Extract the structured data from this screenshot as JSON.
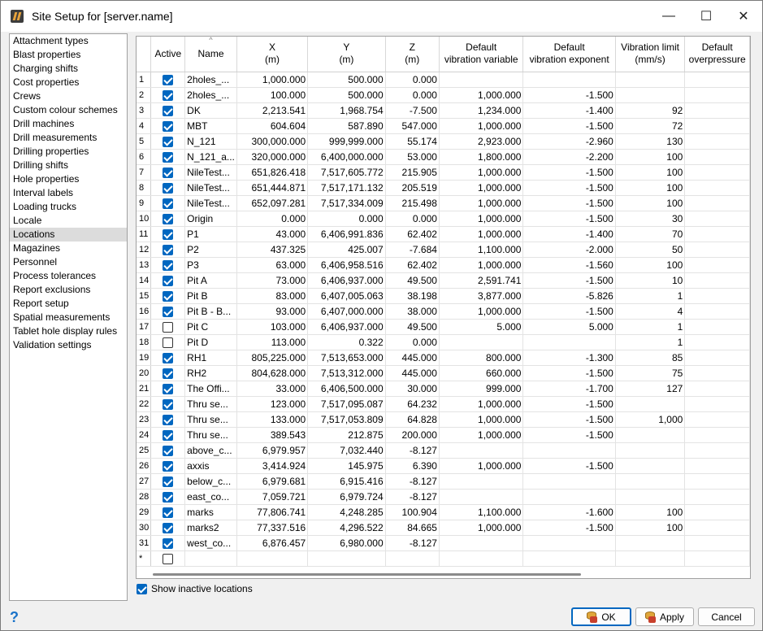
{
  "window": {
    "title": "Site Setup for [server.name]",
    "minimize": "—",
    "maximize": "☐",
    "close": "✕"
  },
  "nav": {
    "items": [
      "Attachment types",
      "Blast properties",
      "Charging shifts",
      "Cost properties",
      "Crews",
      "Custom colour schemes",
      "Drill machines",
      "Drill measurements",
      "Drilling properties",
      "Drilling shifts",
      "Hole properties",
      "Interval labels",
      "Loading trucks",
      "Locale",
      "Locations",
      "Magazines",
      "Personnel",
      "Process tolerances",
      "Report exclusions",
      "Report setup",
      "Spatial measurements",
      "Tablet hole display rules",
      "Validation settings"
    ],
    "selected": "Locations"
  },
  "grid": {
    "columns": [
      {
        "l1": "Active",
        "l2": ""
      },
      {
        "l1": "Name",
        "l2": ""
      },
      {
        "l1": "X",
        "l2": "(m)"
      },
      {
        "l1": "Y",
        "l2": "(m)"
      },
      {
        "l1": "Z",
        "l2": "(m)"
      },
      {
        "l1": "Default",
        "l2": "vibration variable"
      },
      {
        "l1": "Default",
        "l2": "vibration exponent"
      },
      {
        "l1": "Vibration limit",
        "l2": "(mm/s)"
      },
      {
        "l1": "Default",
        "l2": "overpressure"
      }
    ],
    "sort_indicator": "^",
    "rows": [
      {
        "n": "1",
        "a": true,
        "name": "2holes_...",
        "x": "1,000.000",
        "y": "500.000",
        "z": "0.000",
        "vv": "",
        "ve": "",
        "vl": ""
      },
      {
        "n": "2",
        "a": true,
        "name": "2holes_...",
        "x": "100.000",
        "y": "500.000",
        "z": "0.000",
        "vv": "1,000.000",
        "ve": "-1.500",
        "vl": ""
      },
      {
        "n": "3",
        "a": true,
        "name": "DK",
        "x": "2,213.541",
        "y": "1,968.754",
        "z": "-7.500",
        "vv": "1,234.000",
        "ve": "-1.400",
        "vl": "92"
      },
      {
        "n": "4",
        "a": true,
        "name": "MBT",
        "x": "604.604",
        "y": "587.890",
        "z": "547.000",
        "vv": "1,000.000",
        "ve": "-1.500",
        "vl": "72"
      },
      {
        "n": "5",
        "a": true,
        "name": "N_121",
        "x": "300,000.000",
        "y": "999,999.000",
        "z": "55.174",
        "vv": "2,923.000",
        "ve": "-2.960",
        "vl": "130"
      },
      {
        "n": "6",
        "a": true,
        "name": "N_121_a...",
        "x": "320,000.000",
        "y": "6,400,000.000",
        "z": "53.000",
        "vv": "1,800.000",
        "ve": "-2.200",
        "vl": "100"
      },
      {
        "n": "7",
        "a": true,
        "name": "NileTest...",
        "x": "651,826.418",
        "y": "7,517,605.772",
        "z": "215.905",
        "vv": "1,000.000",
        "ve": "-1.500",
        "vl": "100"
      },
      {
        "n": "8",
        "a": true,
        "name": "NileTest...",
        "x": "651,444.871",
        "y": "7,517,171.132",
        "z": "205.519",
        "vv": "1,000.000",
        "ve": "-1.500",
        "vl": "100"
      },
      {
        "n": "9",
        "a": true,
        "name": "NileTest...",
        "x": "652,097.281",
        "y": "7,517,334.009",
        "z": "215.498",
        "vv": "1,000.000",
        "ve": "-1.500",
        "vl": "100"
      },
      {
        "n": "10",
        "a": true,
        "name": "Origin",
        "x": "0.000",
        "y": "0.000",
        "z": "0.000",
        "vv": "1,000.000",
        "ve": "-1.500",
        "vl": "30"
      },
      {
        "n": "11",
        "a": true,
        "name": "P1",
        "x": "43.000",
        "y": "6,406,991.836",
        "z": "62.402",
        "vv": "1,000.000",
        "ve": "-1.400",
        "vl": "70"
      },
      {
        "n": "12",
        "a": true,
        "name": "P2",
        "x": "437.325",
        "y": "425.007",
        "z": "-7.684",
        "vv": "1,100.000",
        "ve": "-2.000",
        "vl": "50"
      },
      {
        "n": "13",
        "a": true,
        "name": "P3",
        "x": "63.000",
        "y": "6,406,958.516",
        "z": "62.402",
        "vv": "1,000.000",
        "ve": "-1.560",
        "vl": "100"
      },
      {
        "n": "14",
        "a": true,
        "name": "Pit A",
        "x": "73.000",
        "y": "6,406,937.000",
        "z": "49.500",
        "vv": "2,591.741",
        "ve": "-1.500",
        "vl": "10"
      },
      {
        "n": "15",
        "a": true,
        "name": "Pit B",
        "x": "83.000",
        "y": "6,407,005.063",
        "z": "38.198",
        "vv": "3,877.000",
        "ve": "-5.826",
        "vl": "1"
      },
      {
        "n": "16",
        "a": true,
        "name": "Pit B - B...",
        "x": "93.000",
        "y": "6,407,000.000",
        "z": "38.000",
        "vv": "1,000.000",
        "ve": "-1.500",
        "vl": "4"
      },
      {
        "n": "17",
        "a": false,
        "name": "Pit C",
        "x": "103.000",
        "y": "6,406,937.000",
        "z": "49.500",
        "vv": "5.000",
        "ve": "5.000",
        "vl": "1"
      },
      {
        "n": "18",
        "a": false,
        "name": "Pit D",
        "x": "113.000",
        "y": "0.322",
        "z": "0.000",
        "vv": "",
        "ve": "",
        "vl": "1"
      },
      {
        "n": "19",
        "a": true,
        "name": "RH1",
        "x": "805,225.000",
        "y": "7,513,653.000",
        "z": "445.000",
        "vv": "800.000",
        "ve": "-1.300",
        "vl": "85"
      },
      {
        "n": "20",
        "a": true,
        "name": "RH2",
        "x": "804,628.000",
        "y": "7,513,312.000",
        "z": "445.000",
        "vv": "660.000",
        "ve": "-1.500",
        "vl": "75"
      },
      {
        "n": "21",
        "a": true,
        "name": "The Offi...",
        "x": "33.000",
        "y": "6,406,500.000",
        "z": "30.000",
        "vv": "999.000",
        "ve": "-1.700",
        "vl": "127"
      },
      {
        "n": "22",
        "a": true,
        "name": "Thru se...",
        "x": "123.000",
        "y": "7,517,095.087",
        "z": "64.232",
        "vv": "1,000.000",
        "ve": "-1.500",
        "vl": ""
      },
      {
        "n": "23",
        "a": true,
        "name": "Thru se...",
        "x": "133.000",
        "y": "7,517,053.809",
        "z": "64.828",
        "vv": "1,000.000",
        "ve": "-1.500",
        "vl": "1,000"
      },
      {
        "n": "24",
        "a": true,
        "name": "Thru se...",
        "x": "389.543",
        "y": "212.875",
        "z": "200.000",
        "vv": "1,000.000",
        "ve": "-1.500",
        "vl": ""
      },
      {
        "n": "25",
        "a": true,
        "name": "above_c...",
        "x": "6,979.957",
        "y": "7,032.440",
        "z": "-8.127",
        "vv": "",
        "ve": "",
        "vl": ""
      },
      {
        "n": "26",
        "a": true,
        "name": "axxis",
        "x": "3,414.924",
        "y": "145.975",
        "z": "6.390",
        "vv": "1,000.000",
        "ve": "-1.500",
        "vl": ""
      },
      {
        "n": "27",
        "a": true,
        "name": "below_c...",
        "x": "6,979.681",
        "y": "6,915.416",
        "z": "-8.127",
        "vv": "",
        "ve": "",
        "vl": ""
      },
      {
        "n": "28",
        "a": true,
        "name": "east_co...",
        "x": "7,059.721",
        "y": "6,979.724",
        "z": "-8.127",
        "vv": "",
        "ve": "",
        "vl": ""
      },
      {
        "n": "29",
        "a": true,
        "name": "marks",
        "x": "77,806.741",
        "y": "4,248.285",
        "z": "100.904",
        "vv": "1,100.000",
        "ve": "-1.600",
        "vl": "100"
      },
      {
        "n": "30",
        "a": true,
        "name": "marks2",
        "x": "77,337.516",
        "y": "4,296.522",
        "z": "84.665",
        "vv": "1,000.000",
        "ve": "-1.500",
        "vl": "100"
      },
      {
        "n": "31",
        "a": true,
        "name": "west_co...",
        "x": "6,876.457",
        "y": "6,980.000",
        "z": "-8.127",
        "vv": "",
        "ve": "",
        "vl": ""
      }
    ],
    "new_row_marker": "*"
  },
  "footer": {
    "show_inactive_label": "Show inactive locations",
    "show_inactive_checked": true,
    "help": "?",
    "ok": "OK",
    "apply": "Apply",
    "cancel": "Cancel"
  },
  "colors": {
    "accent": "#0067c0",
    "selected_nav": "#dcdcdc"
  }
}
